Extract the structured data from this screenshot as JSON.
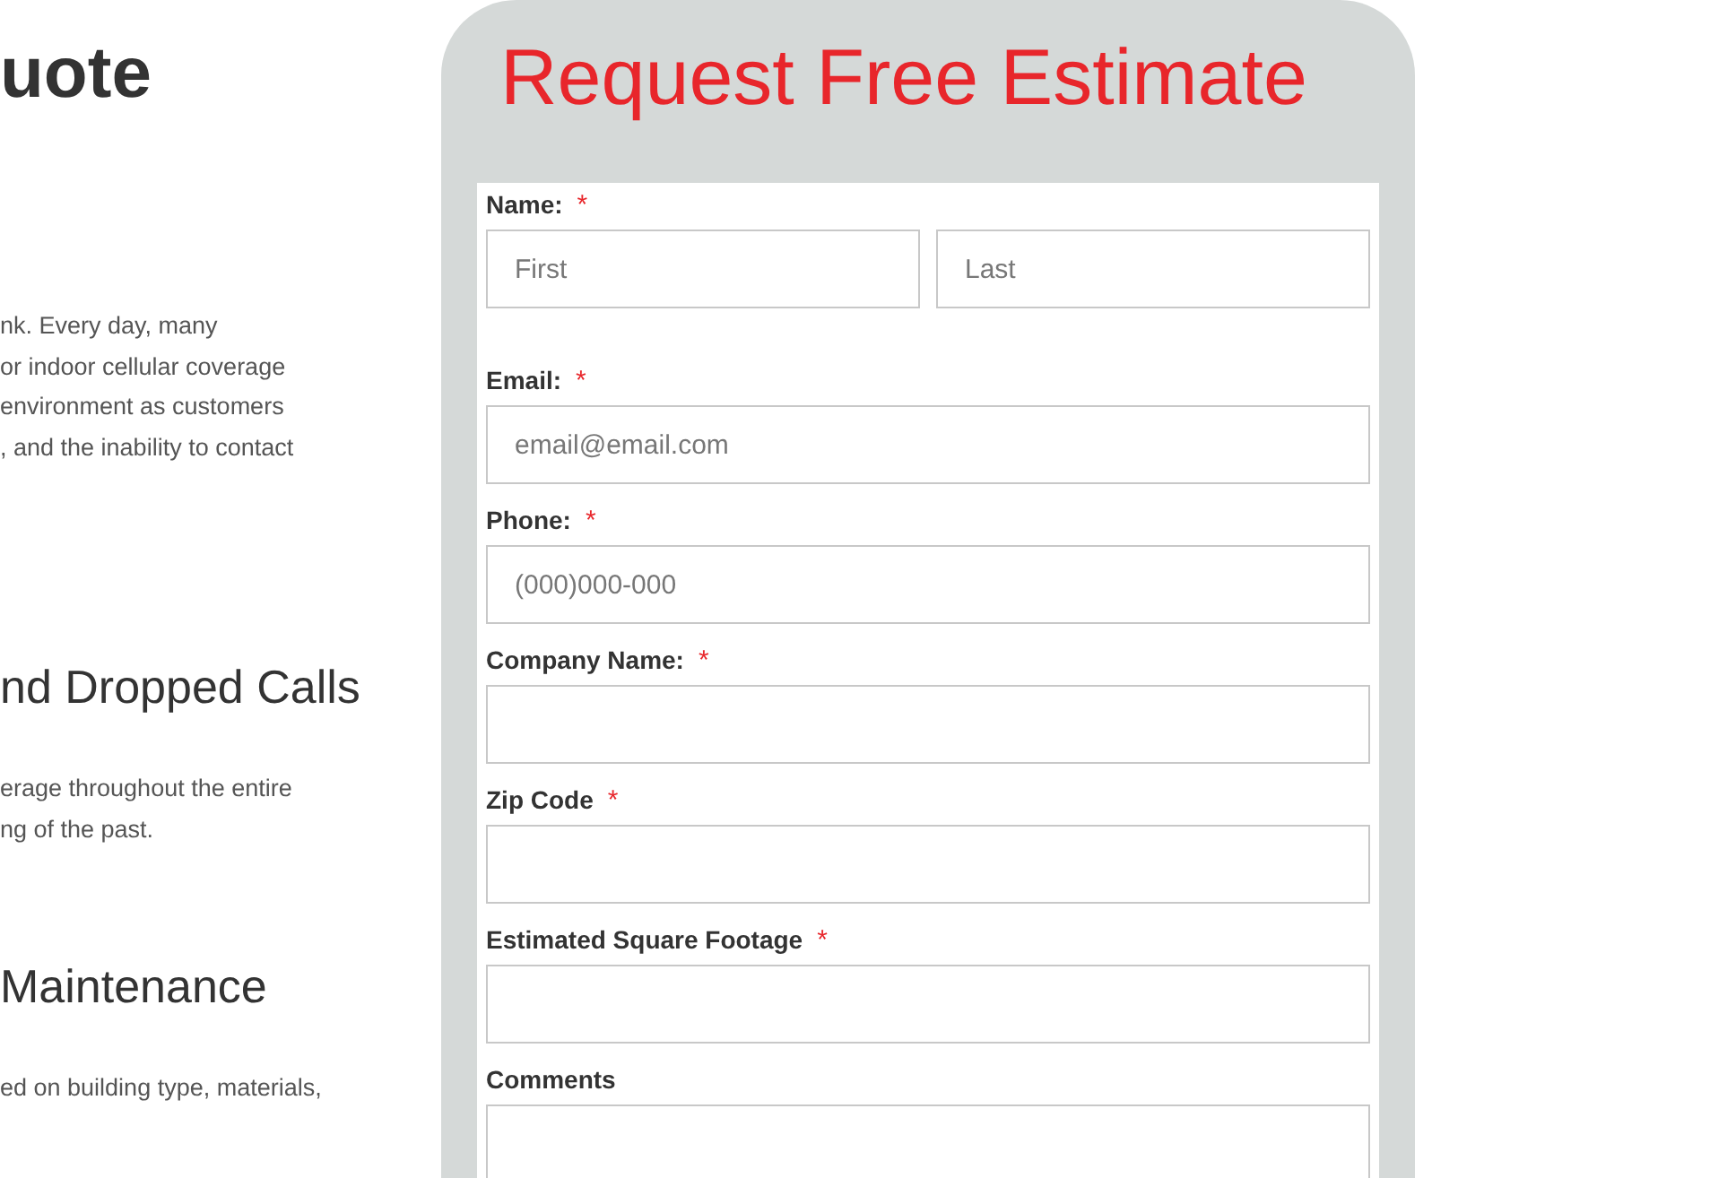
{
  "left_column": [
    {
      "kind": "title",
      "text": "uote"
    },
    {
      "kind": "paragraph",
      "lines": [
        "nk. Every day, many",
        "or indoor cellular coverage",
        "environment as customers",
        ", and the inability to contact"
      ]
    },
    {
      "kind": "heading",
      "text": "nd Dropped Calls"
    },
    {
      "kind": "paragraph",
      "lines": [
        "erage throughout the entire",
        "ng of the past."
      ]
    },
    {
      "kind": "heading",
      "text": "Maintenance"
    },
    {
      "kind": "paragraph",
      "lines": [
        "ed on building type, materials,"
      ]
    }
  ],
  "form": {
    "title": "Request Free Estimate",
    "fields": [
      {
        "kind": "name",
        "label": "Name:",
        "required_mark": "*",
        "placeholders": [
          "First",
          "Last"
        ]
      },
      {
        "kind": "input",
        "label": "Email:",
        "required_mark": "*",
        "placeholder": "email@email.com"
      },
      {
        "kind": "input",
        "label": "Phone:",
        "required_mark": "*",
        "placeholder": "(000)000-000"
      },
      {
        "kind": "input",
        "label": "Company Name:",
        "required_mark": "*"
      },
      {
        "kind": "input",
        "label": "Zip Code",
        "required_mark": "*"
      },
      {
        "kind": "input",
        "label": "Estimated Square Footage",
        "required_mark": "*"
      },
      {
        "kind": "textarea",
        "label": "Comments"
      }
    ]
  }
}
